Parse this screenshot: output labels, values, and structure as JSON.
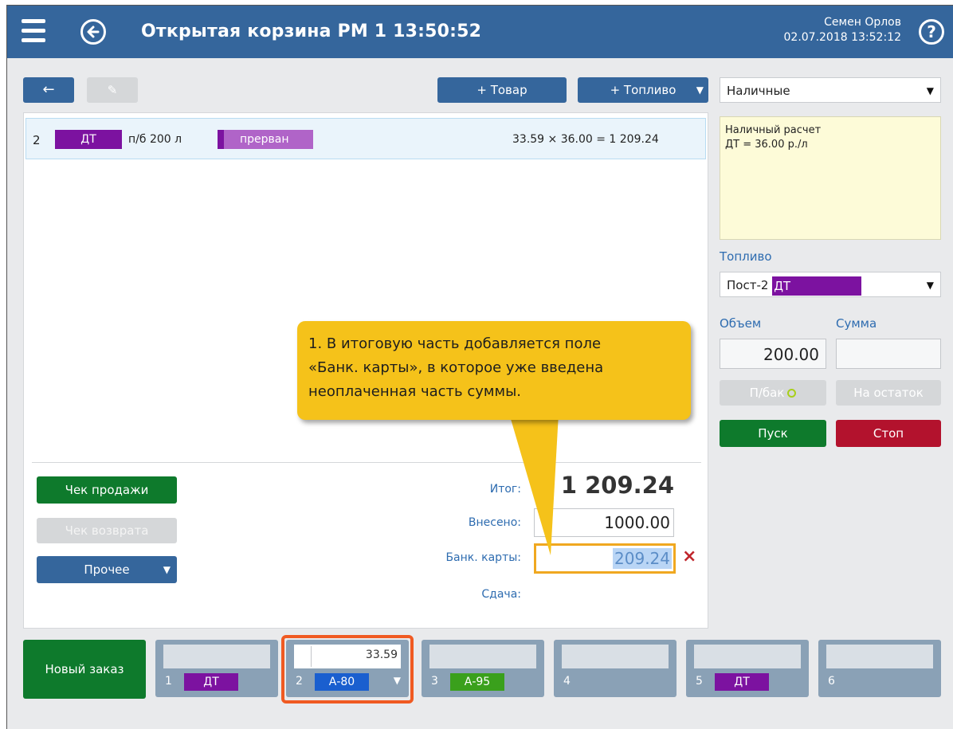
{
  "header": {
    "title": "Открытая корзина  РМ 1  13:50:52",
    "user_name": "Семен Орлов",
    "datetime": "02.07.2018 13:52:12",
    "help_label": "?"
  },
  "toolbar": {
    "back_label": "←",
    "edit_label": "✎",
    "add_product_label": "+ Товар",
    "add_fuel_label": "+ Топливо",
    "dropdown_caret": "▼"
  },
  "order": {
    "row_number": "2",
    "fuel_type": "ДТ",
    "fuel_color": "#7c12a0",
    "volume_text": "п/б 200 л",
    "status": "прерван",
    "status_color": "#b064c8",
    "calculation": "33.59 × 36.00 = 1 209.24"
  },
  "payment": {
    "method": "Наличные",
    "info_line1": "Наличный расчет",
    "info_line2": "ДТ = 36.00 р./л"
  },
  "fuel_panel": {
    "label": "Топливо",
    "post_label": "Пост-2",
    "fuel_chip": "ДТ",
    "volume_label": "Объем",
    "sum_label": "Сумма",
    "volume_value": "200.00",
    "sum_value": "",
    "full_tank_label": "П/бак",
    "remainder_label": "На остаток",
    "start_label": "Пуск",
    "stop_label": "Стоп"
  },
  "actions": {
    "sale_receipt_label": "Чек продажи",
    "return_receipt_label": "Чек возврата",
    "other_label": "Прочее"
  },
  "totals": {
    "total_label": "Итог:",
    "total_value": "1 209.24",
    "paid_label": "Внесено:",
    "paid_value": "1000.00",
    "card_label": "Банк. карты:",
    "card_value": "209.24",
    "change_label": "Сдача:",
    "change_value": "",
    "clear_label": "×"
  },
  "callout": {
    "text": "1. В итоговую часть добавляется поле\n  «Банк. карты», в которое уже введена\n   неоплаченная часть суммы."
  },
  "bottom": {
    "new_order_label": "Новый заказ",
    "posts": [
      {
        "number": "1",
        "fuel": "ДТ",
        "color": "#7c12a0",
        "value": ""
      },
      {
        "number": "2",
        "fuel": "А-80",
        "color": "#1a5fcf",
        "value": "33.59"
      },
      {
        "number": "3",
        "fuel": "А-95",
        "color": "#3aa01c",
        "value": ""
      },
      {
        "number": "4",
        "fuel": "",
        "color": "",
        "value": ""
      },
      {
        "number": "5",
        "fuel": "ДТ",
        "color": "#7c12a0",
        "value": ""
      },
      {
        "number": "6",
        "fuel": "",
        "color": "",
        "value": ""
      }
    ]
  }
}
